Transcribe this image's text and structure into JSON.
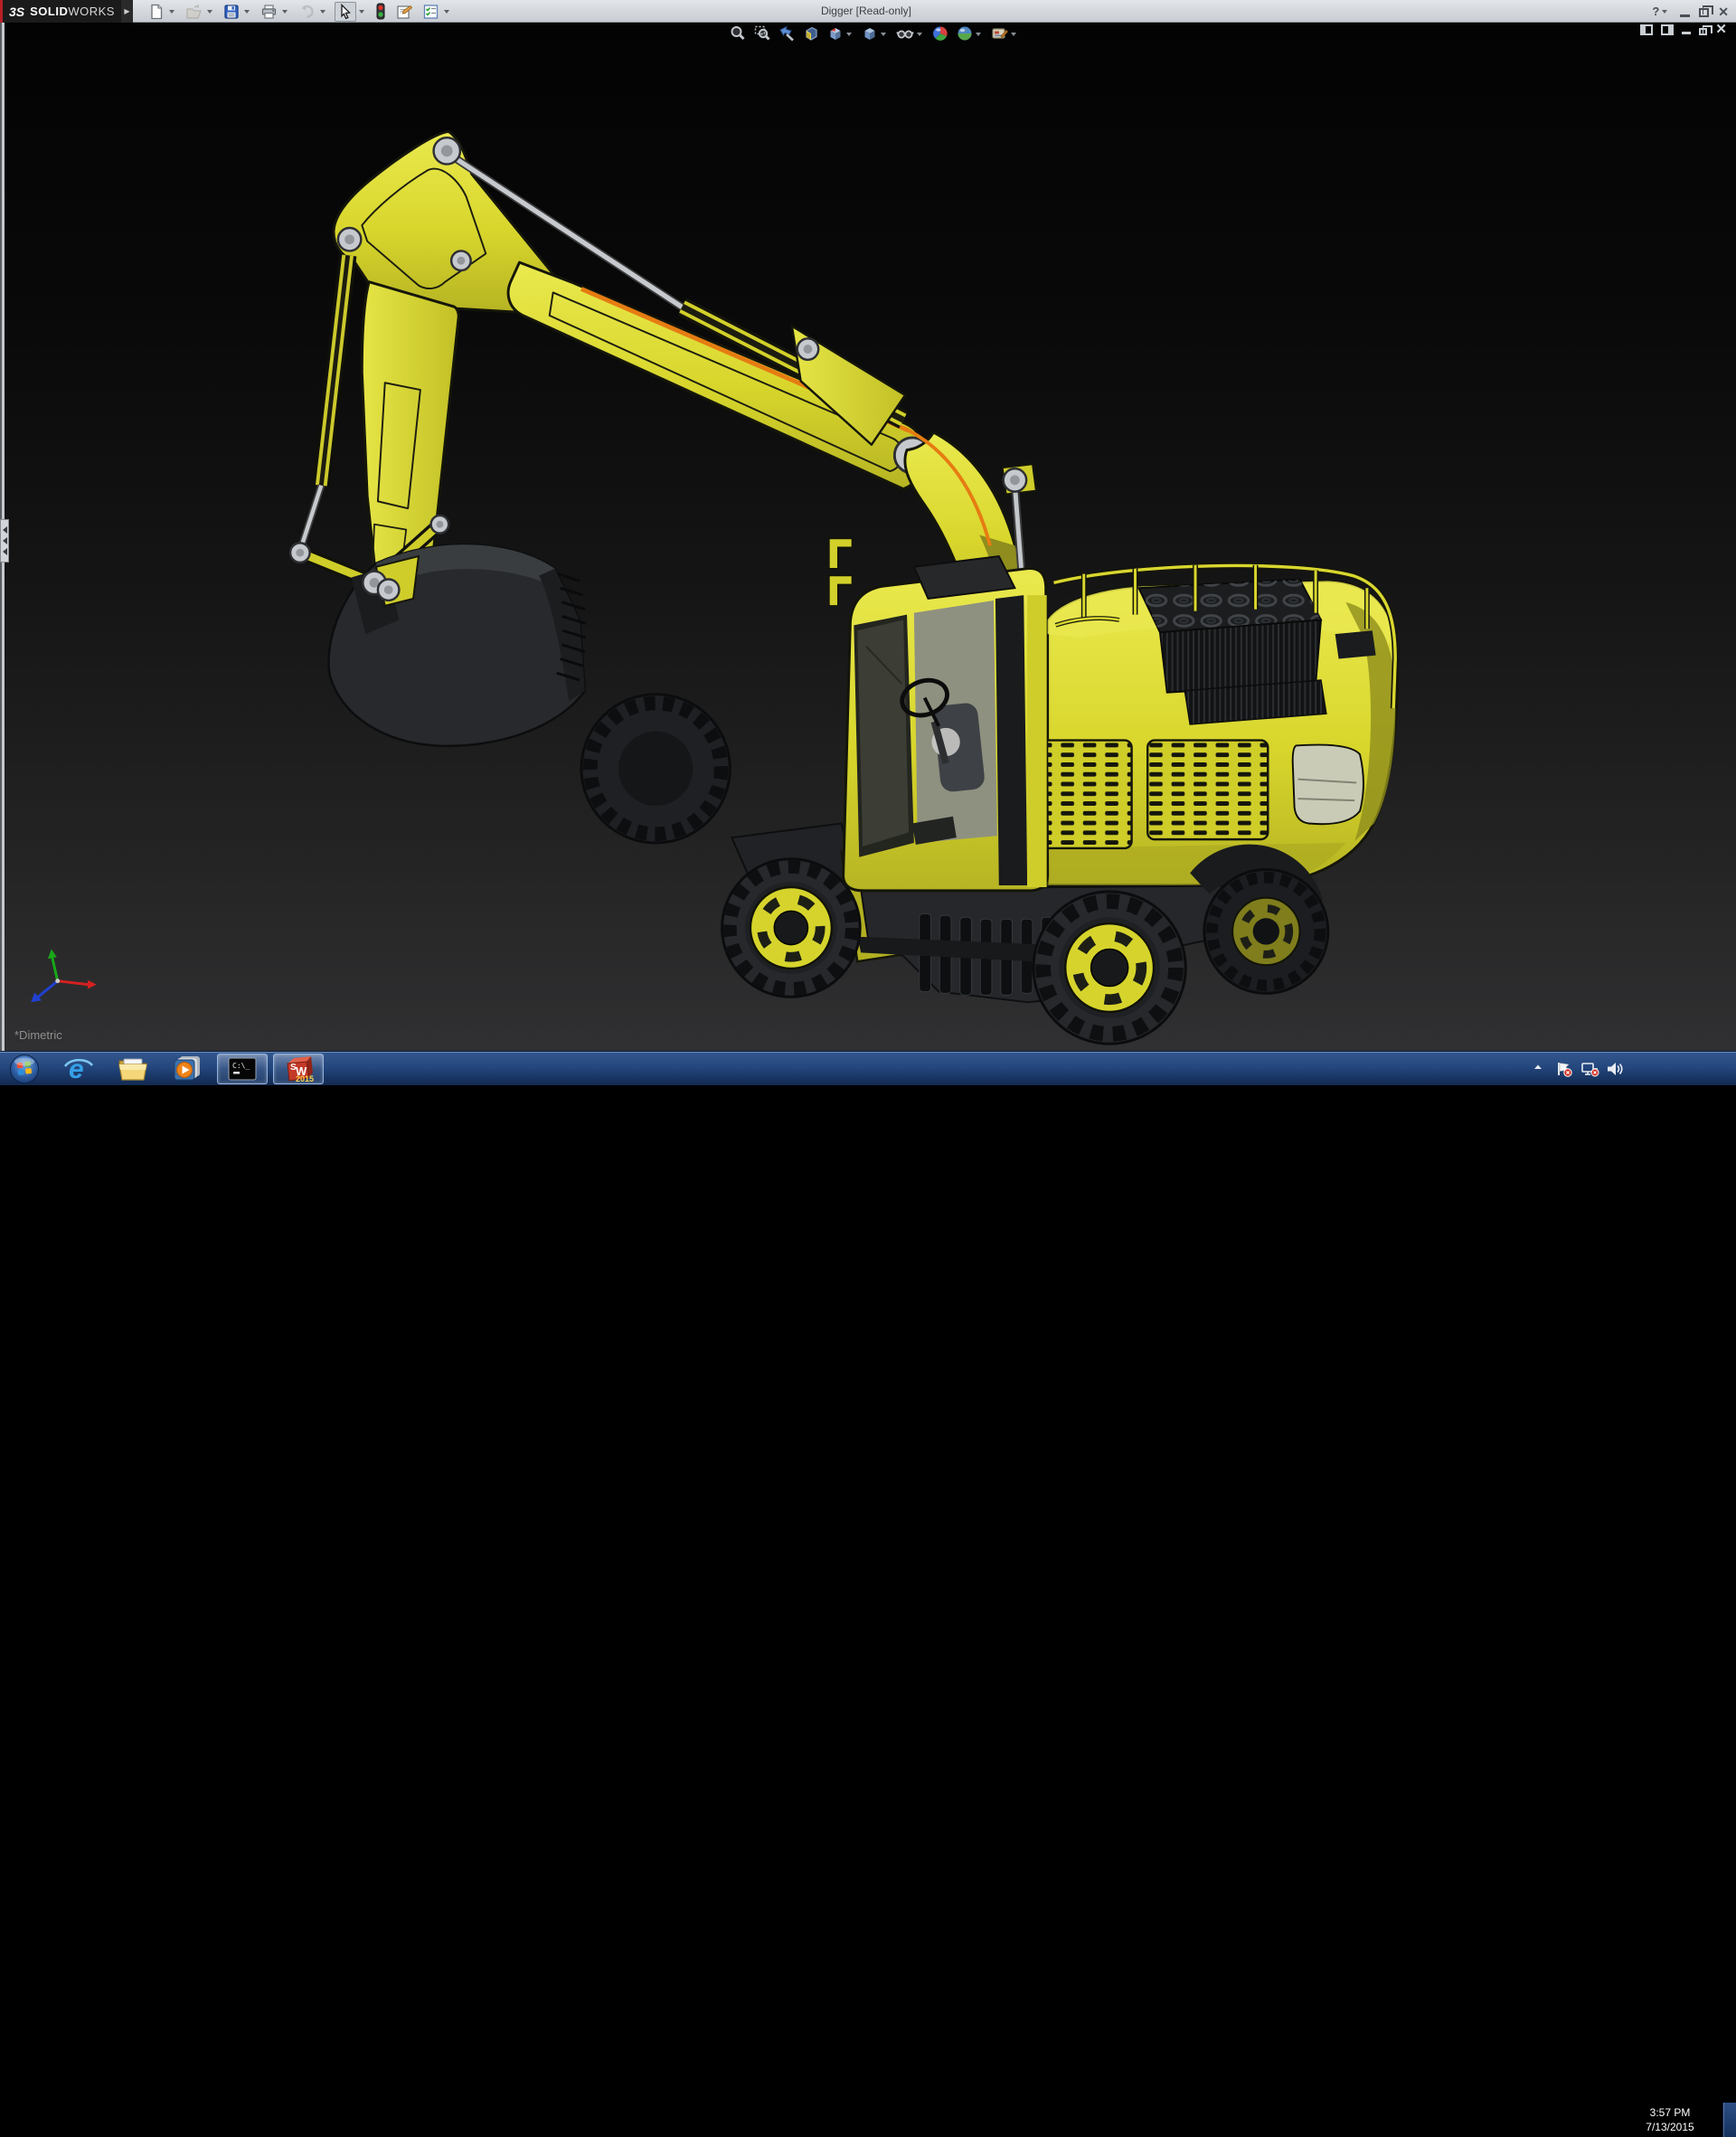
{
  "titlebar": {
    "brand": {
      "mark": "3S",
      "name_bold": "SOLID",
      "name_light": "WORKS"
    },
    "title": "Digger [Read-only]",
    "help_label": "?",
    "toolbar_icons": [
      "new-document",
      "open",
      "save",
      "print",
      "undo",
      "select",
      "rebuild-traffic-light",
      "file-properties",
      "options"
    ]
  },
  "viewport": {
    "headsup_icons": [
      "zoom-to-fit",
      "zoom-to-area",
      "previous-view",
      "section-view",
      "view-orientation",
      "display-style",
      "hide-show-items",
      "edit-appearance",
      "apply-scene",
      "view-settings"
    ],
    "window_controls": [
      "pane-left-icon",
      "pane-right-icon",
      "minimize",
      "restore",
      "close"
    ],
    "orientation_label": "*Dimetric",
    "model_name": "Digger excavator 3D model",
    "colors": {
      "background_top": "#030303",
      "background_bottom": "#303032",
      "model_yellow": "#d8d62c",
      "accent_stripe": "#e07818",
      "hardware_gray": "#c6c9cd",
      "dark_parts": "#26282b"
    },
    "triad_axes": [
      "x-red",
      "y-green",
      "z-blue"
    ]
  },
  "taskbar": {
    "items": [
      {
        "name": "start-button"
      },
      {
        "name": "internet-explorer"
      },
      {
        "name": "windows-explorer"
      },
      {
        "name": "media-player"
      },
      {
        "name": "command-prompt",
        "label": "C:\\_",
        "running": true
      },
      {
        "name": "solidworks-2015",
        "label_s": "S",
        "label_w": "W",
        "label_year": "2015",
        "running": true
      }
    ],
    "tray": {
      "icons": [
        "hidden-icons-arrow",
        "action-center-flag",
        "network-disconnected",
        "volume"
      ],
      "clock_time": "3:57 PM",
      "clock_date": "7/13/2015"
    }
  }
}
